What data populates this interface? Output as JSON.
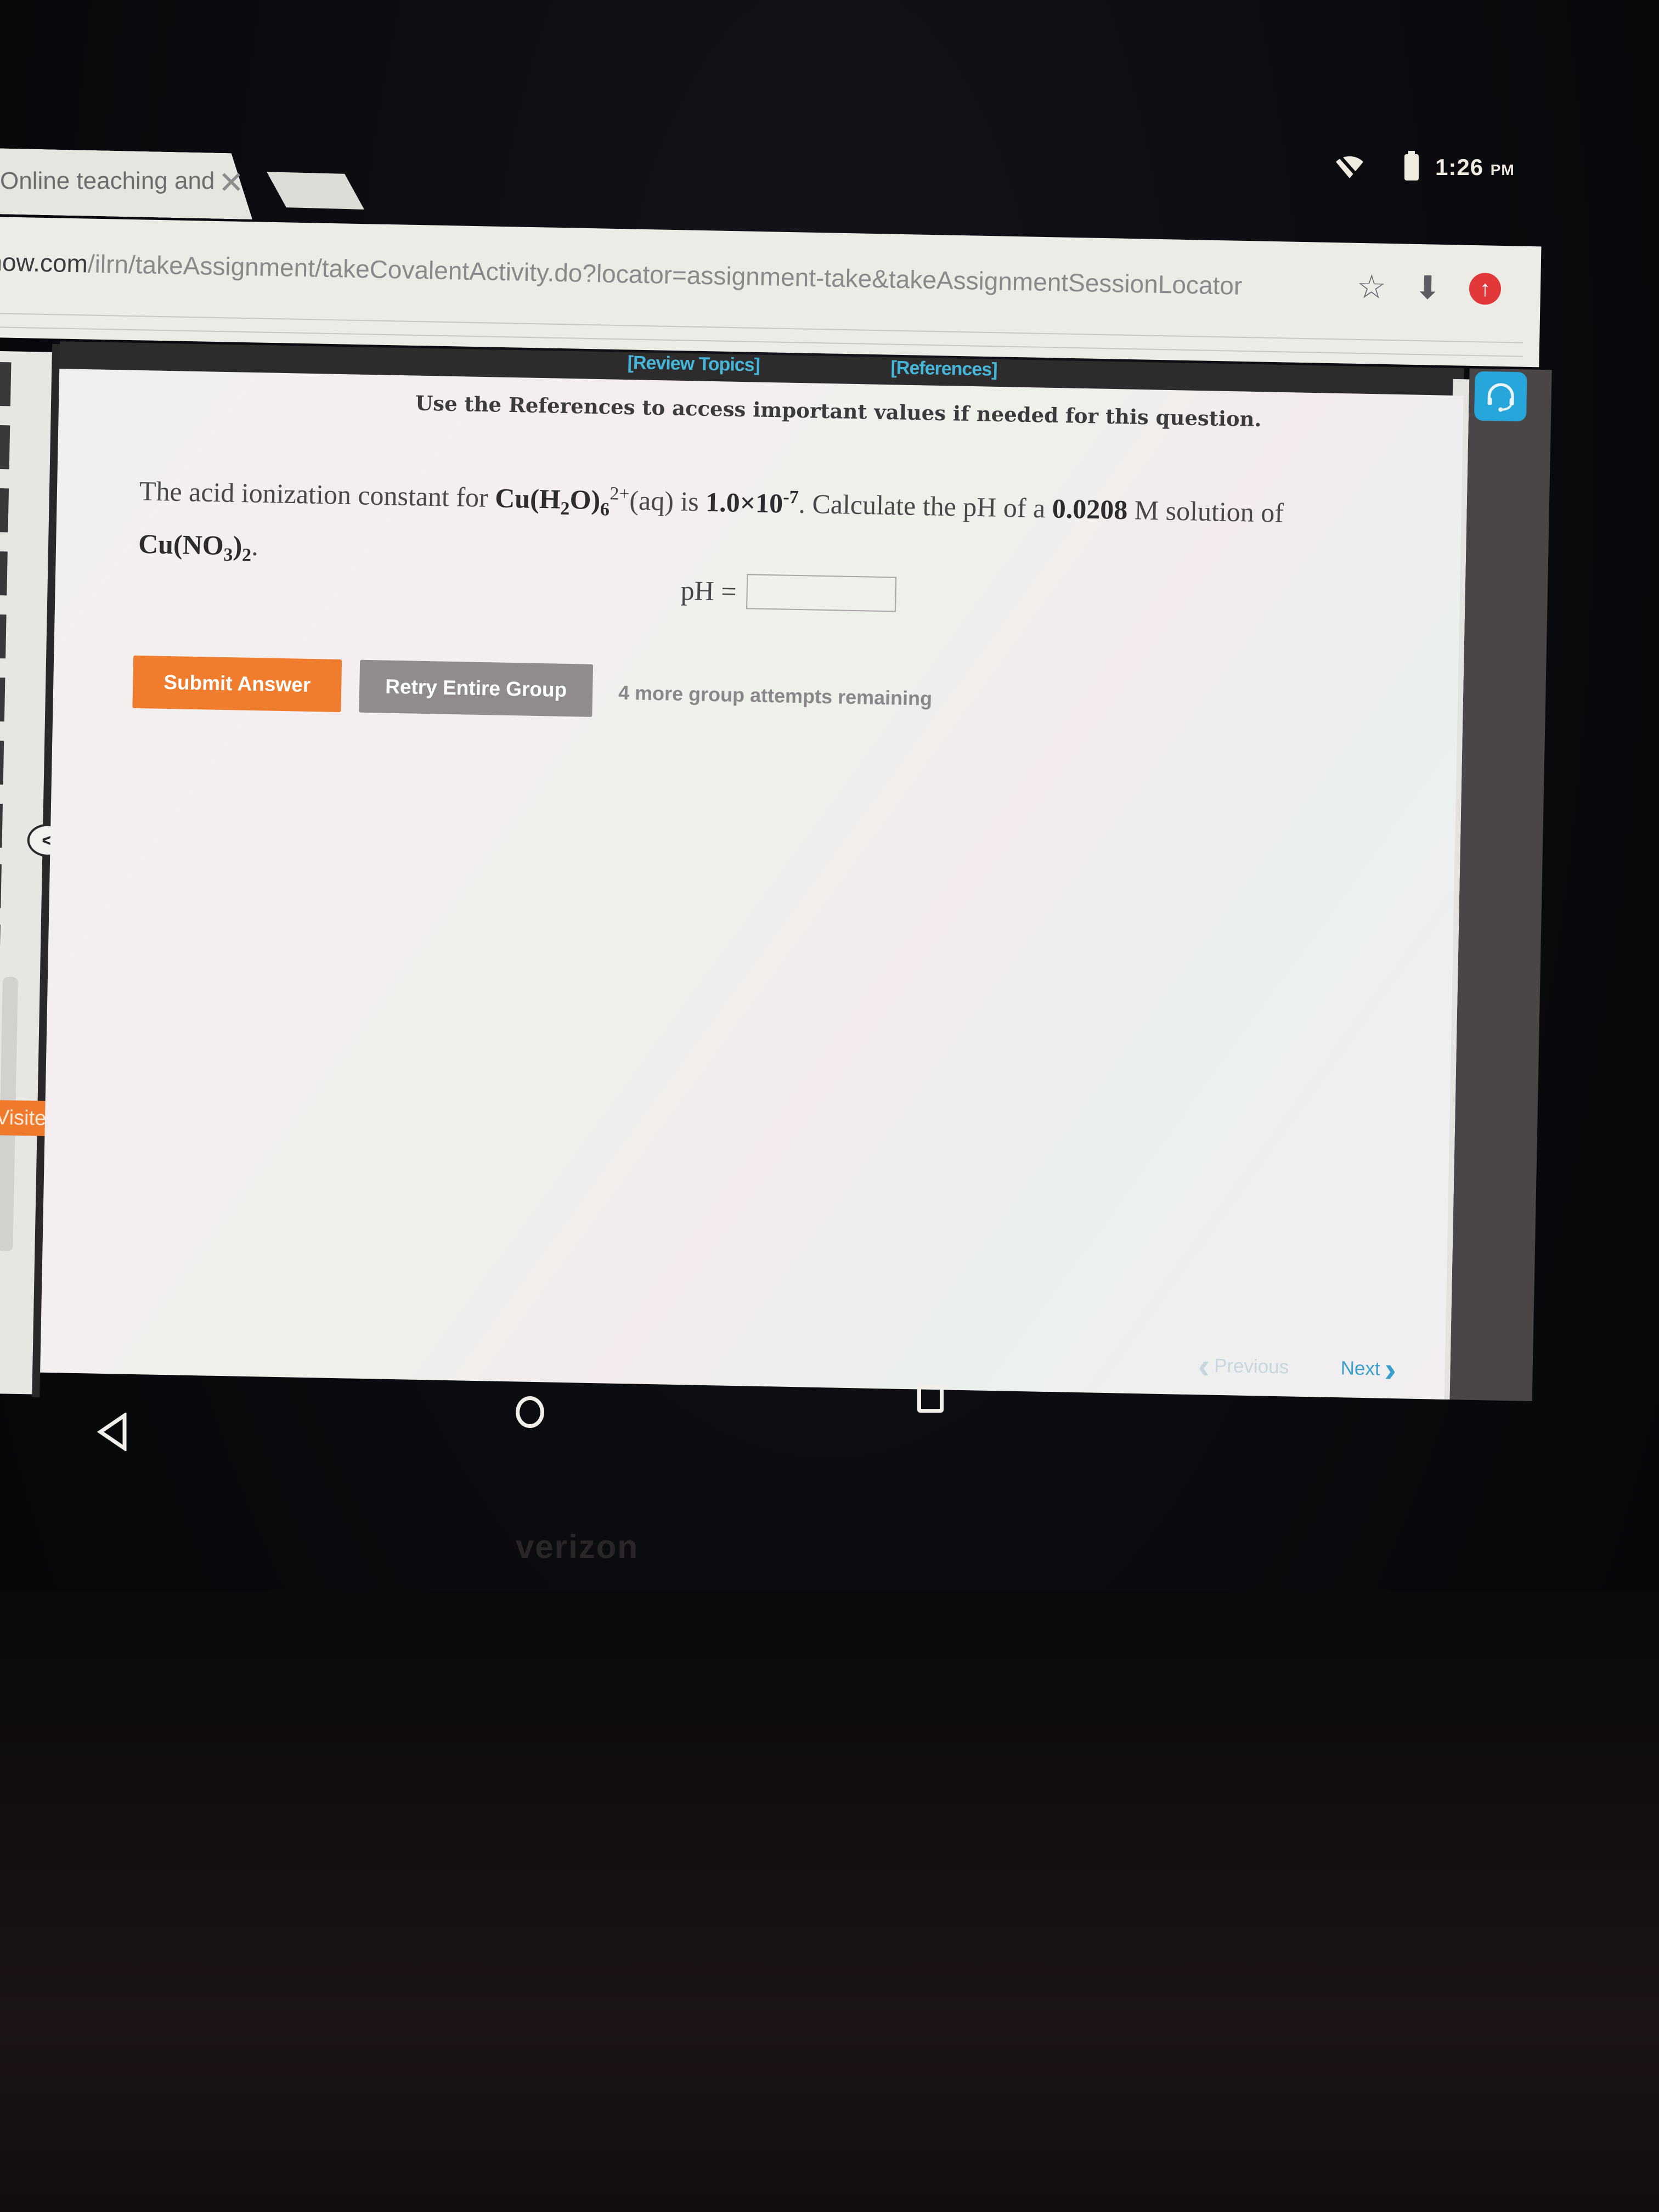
{
  "status_bar": {
    "time": "1:26",
    "ampm": "PM",
    "icons": [
      "wifi-off-icon",
      "battery-icon"
    ]
  },
  "browser": {
    "tab_title": "Online teaching and",
    "url_host": "now.com",
    "url_path": "/ilrn/takeAssignment/takeCovalentActivity.do?locator=assignment-take&takeAssignmentSessionLocator",
    "toolbar_icons": [
      "star-icon",
      "download-icon",
      "update-icon"
    ]
  },
  "assignment": {
    "top_links": {
      "review_topics": "[Review Topics]",
      "references": "[References]"
    },
    "reference_note": "Use the References to access important values if needed for this question.",
    "question": {
      "intro": "The acid ionization constant for ",
      "species": "Cu(H",
      "species_sub1": "2",
      "species_mid": "O)",
      "species_sub2": "6",
      "species_sup": "2+",
      "phase": "(aq) is ",
      "ka_value": "1.0×10",
      "ka_exp": "-7",
      "middle": ". Calculate the pH of a ",
      "concentration": "0.0208",
      "unit": " M solution of",
      "salt_a": "Cu(NO",
      "salt_sub1": "3",
      "salt_b": ")",
      "salt_sub2": "2",
      "end": "."
    },
    "answer": {
      "label": "pH =",
      "value": "",
      "placeholder": ""
    },
    "buttons": {
      "submit": "Submit Answer",
      "retry": "Retry Entire Group"
    },
    "attempts_text": "4 more group attempts remaining",
    "sidebar": {
      "visited_label": "Visited",
      "collapse_label": "<"
    },
    "pager": {
      "previous": "Previous",
      "next": "Next"
    }
  },
  "device": {
    "brand": "verizon"
  },
  "colors": {
    "submit": "#f07d2e",
    "retry": "#8f8c8b",
    "link": "#45b6d9",
    "visited": "#f07a2c",
    "help": "#27a6db"
  }
}
